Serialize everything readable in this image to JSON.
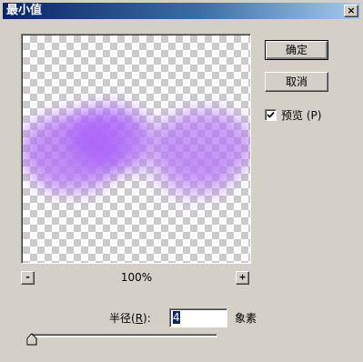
{
  "window": {
    "title": "最小值",
    "close_label": "×"
  },
  "buttons": {
    "ok_label": "确定",
    "cancel_label": "取消",
    "zoom_out_label": "-",
    "zoom_in_label": "+"
  },
  "preview": {
    "checked": true,
    "label": "预览",
    "mnemonic": "(P)",
    "zoom": "100%"
  },
  "radius": {
    "label_prefix": "半径(",
    "label_mnemonic": "R",
    "label_suffix": "):",
    "value": "4",
    "unit": "象素"
  },
  "slider": {
    "value": 4
  },
  "colors": {
    "title_gradient_start": "#0a246a",
    "title_gradient_end": "#a6caf0",
    "dialog_bg": "#d4d0c8",
    "preview_tint": "#b06ef5"
  }
}
